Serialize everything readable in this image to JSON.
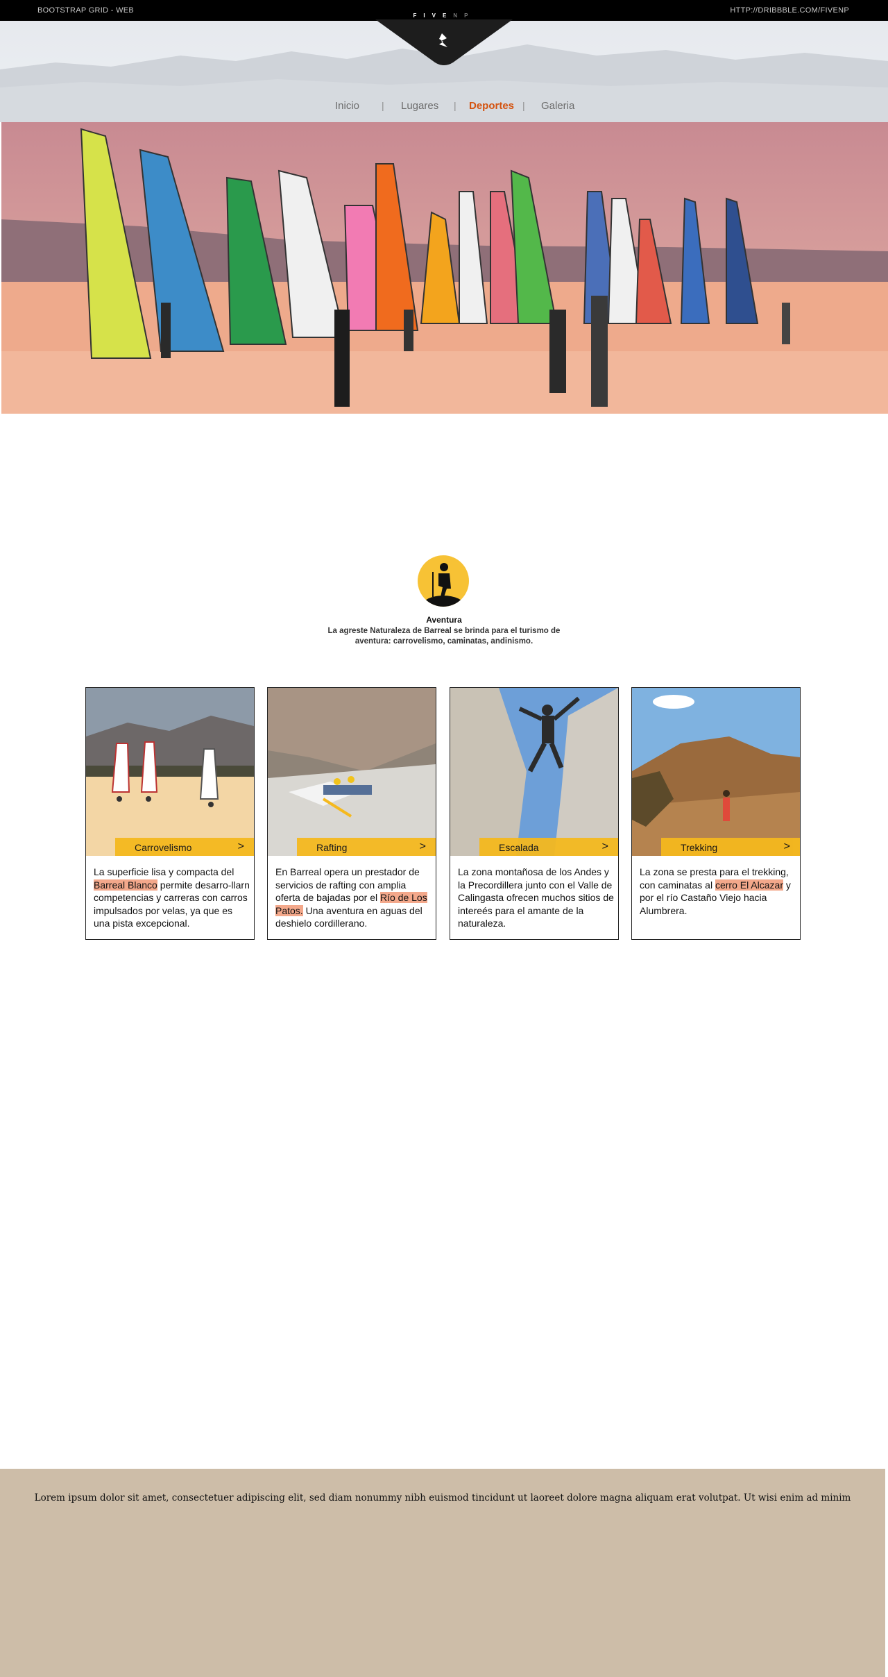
{
  "topbar": {
    "left_text": "BOOTSTRAP GRID - WEB",
    "right_text": "HTTP://DRIBBBLE.COM/FIVENP",
    "logo_word_main": "FIVE",
    "logo_word_dim": "NP"
  },
  "nav": {
    "items": [
      {
        "label": "Inicio"
      },
      {
        "label": "Lugares"
      },
      {
        "label": "Deportes",
        "active": true
      },
      {
        "label": "Galeria"
      }
    ],
    "separator": "|"
  },
  "intro": {
    "icon": "hiker-silhouette-icon",
    "title": "Aventura",
    "text": "La agreste Naturaleza de Barreal se brinda para el turismo de aventura: carrovelismo, caminatas, andinismo."
  },
  "cards": [
    {
      "title": "Carrovelismo",
      "arrow": ">",
      "text_before": "La superficie lisa y compacta del ",
      "highlight": "Barreal Blanco",
      "text_after": " permite desarro-llarn competencias y carreras con carros impulsados por velas, ya que es una pista excepcional."
    },
    {
      "title": "Rafting",
      "arrow": ">",
      "text_before": "En Barreal opera un prestador de servicios de rafting con amplia oferta de bajadas por el ",
      "highlight": "Río de Los Patos.",
      "text_after": " Una aventura en aguas del deshielo cordillerano."
    },
    {
      "title": "Escalada",
      "arrow": ">",
      "text_before": "La zona montañosa de los Andes y la Precordillera junto con el Valle de Calingasta ofrecen muchos sitios de intereés para el amante de la naturaleza.",
      "highlight": "",
      "text_after": ""
    },
    {
      "title": "Trekking",
      "arrow": ">",
      "text_before": "La zona se presta para el trekking, con caminatas al ",
      "highlight": "cerro El Alcazar",
      "text_after": " y por el río Castaño Viejo hacia Alumbrera."
    }
  ],
  "footer": {
    "text": "Lorem ipsum dolor sit amet, consectetuer adipiscing elit, sed diam nonummy nibh euismod tincidunt ut laoreet dolore magna aliquam erat volutpat. Ut wisi enim ad minim"
  },
  "colors": {
    "accent_orange": "#d4530f",
    "label_yellow": "#f5b91e",
    "icon_yellow": "#f7c235",
    "highlight": "#f3a88b",
    "footer_bg": "#cdbda8"
  }
}
